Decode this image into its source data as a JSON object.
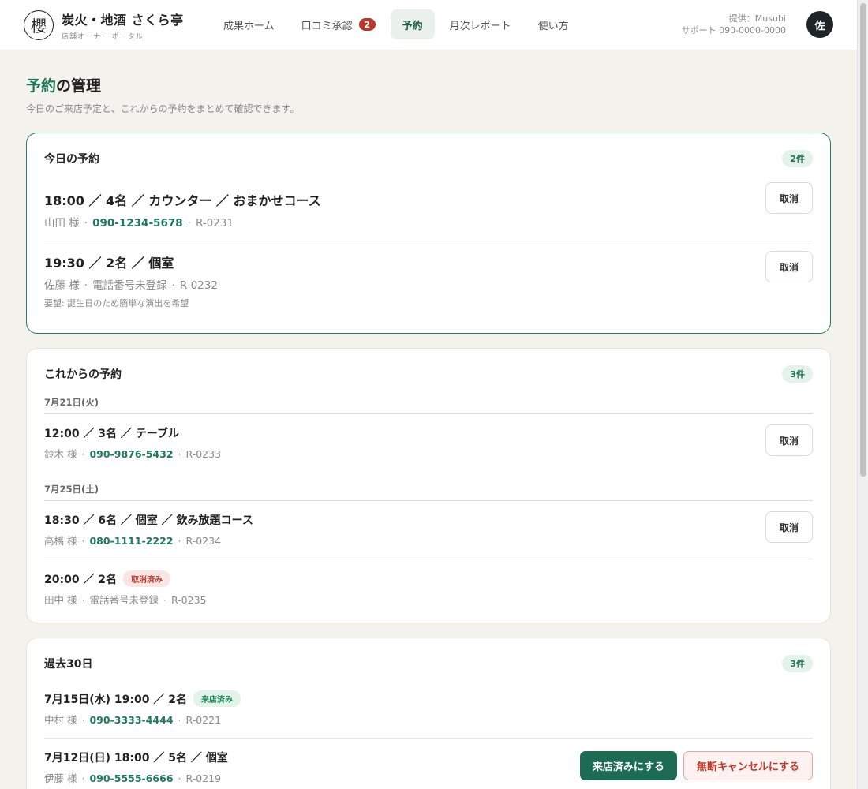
{
  "header": {
    "logo_char": "櫻",
    "store_name": "炭火・地酒 さくら亭",
    "portal_label": "店舗オーナー ポータル",
    "nav": [
      {
        "label": "成果ホーム"
      },
      {
        "label": "口コミ承認",
        "badge": "2"
      },
      {
        "label": "予約",
        "active": true
      },
      {
        "label": "月次レポート"
      },
      {
        "label": "使い方"
      }
    ],
    "provider": "提供：Musubi",
    "support": "サポート 090-0000-0000",
    "avatar": "佐"
  },
  "page": {
    "title_accent": "予約",
    "title_rest": "の管理",
    "description": "今日のご来店予定と、これからの予約をまとめて確認できます。"
  },
  "cancel_label": "取消",
  "today": {
    "title": "今日の予約",
    "count": "2件",
    "items": [
      {
        "main": "18:00 ／ 4名 ／ カウンター ／ おまかせコース",
        "name": "山田 様",
        "phone": "090-1234-5678",
        "id": "R-0231"
      },
      {
        "main": "19:30 ／ 2名 ／ 個室",
        "name": "佐藤 様",
        "phone_missing": "電話番号未登録",
        "id": "R-0232",
        "note": "要望: 誕生日のため簡単な演出を希望"
      }
    ]
  },
  "upcoming": {
    "title": "これからの予約",
    "count": "3件",
    "groups": [
      {
        "date": "7月21日(火)",
        "items": [
          {
            "main": "12:00 ／ 3名 ／ テーブル",
            "name": "鈴木 様",
            "phone": "090-9876-5432",
            "id": "R-0233"
          }
        ]
      },
      {
        "date": "7月25日(土)",
        "items": [
          {
            "main": "18:30 ／ 6名 ／ 個室 ／ 飲み放題コース",
            "name": "高橋 様",
            "phone": "080-1111-2222",
            "id": "R-0234"
          },
          {
            "main": "20:00 ／ 2名",
            "status": "取消済み",
            "name": "田中 様",
            "phone_missing": "電話番号未登録",
            "id": "R-0235"
          }
        ]
      }
    ]
  },
  "past": {
    "title": "過去30日",
    "count": "3件",
    "items": [
      {
        "main": "7月15日(水) 19:00 ／ 2名",
        "status": "来店済み",
        "name": "中村 様",
        "phone": "090-3333-4444",
        "id": "R-0221"
      },
      {
        "main": "7月12日(日) 18:00 ／ 5名 ／ 個室",
        "name": "伊藤 様",
        "phone": "090-5555-6666",
        "id": "R-0219",
        "visit_button": "来店済みにする",
        "noshow_button": "無断キャンセルにする"
      }
    ]
  },
  "colors": {
    "accent": "#1f7a5a",
    "nav_active_bg": "#eaf1ec",
    "badge": "#b5392c",
    "cancelled_pill_bg": "#fbe5e3",
    "visited_pill_bg": "#e2f3e9"
  }
}
